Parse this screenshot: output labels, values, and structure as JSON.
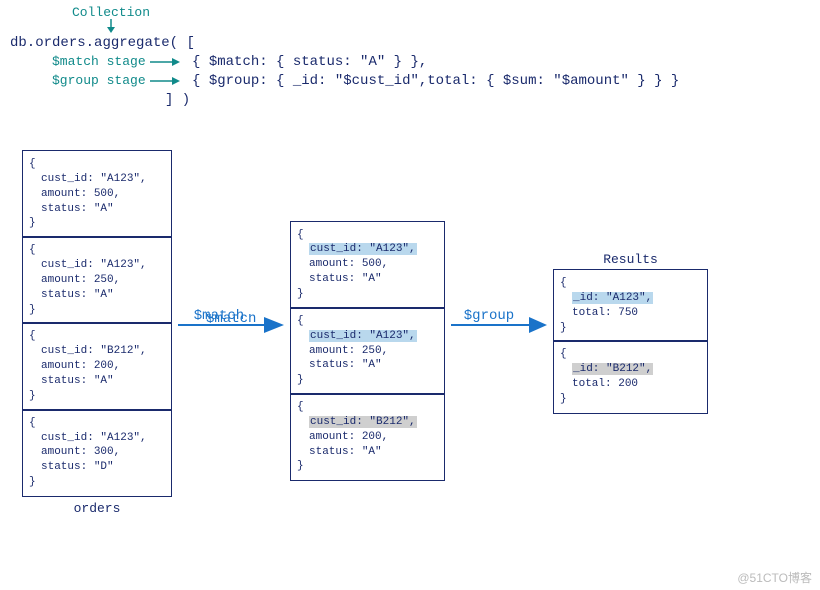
{
  "code": {
    "collection_label": "Collection",
    "line1_pre": "db.",
    "line1_coll": "orders",
    "line1_post": ".aggregate( [",
    "match_label": "$match stage",
    "match_line": "{ $match: { status: \"A\" } },",
    "group_label": "$group stage",
    "group_line": "{ $group: { _id: \"$cust_id\",total: { $sum: \"$amount\" } } }",
    "close_line": "] )"
  },
  "stages": {
    "match": "$match",
    "group": "$group"
  },
  "orders_title": "orders",
  "orders": [
    {
      "cust_id": "\"A123\"",
      "amount": "500",
      "status": "\"A\""
    },
    {
      "cust_id": "\"A123\"",
      "amount": "250",
      "status": "\"A\""
    },
    {
      "cust_id": "\"B212\"",
      "amount": "200",
      "status": "\"A\""
    },
    {
      "cust_id": "\"A123\"",
      "amount": "300",
      "status": "\"D\""
    }
  ],
  "matched": [
    {
      "cust_id": "\"A123\"",
      "amount": "500",
      "status": "\"A\"",
      "hl": "blue"
    },
    {
      "cust_id": "\"A123\"",
      "amount": "250",
      "status": "\"A\"",
      "hl": "blue"
    },
    {
      "cust_id": "\"B212\"",
      "amount": "200",
      "status": "\"A\"",
      "hl": "gray"
    }
  ],
  "results_title": "Results",
  "results": [
    {
      "_id": "\"A123\"",
      "total": "750",
      "hl": "blue"
    },
    {
      "_id": "\"B212\"",
      "total": "200",
      "hl": "gray"
    }
  ],
  "watermark": "@51CTO博客",
  "chart_data": {
    "type": "table",
    "description": "MongoDB aggregation pipeline diagram: db.orders.aggregate with $match then $group",
    "input_collection": "orders",
    "input_docs": [
      {
        "cust_id": "A123",
        "amount": 500,
        "status": "A"
      },
      {
        "cust_id": "A123",
        "amount": 250,
        "status": "A"
      },
      {
        "cust_id": "B212",
        "amount": 200,
        "status": "A"
      },
      {
        "cust_id": "A123",
        "amount": 300,
        "status": "D"
      }
    ],
    "pipeline": [
      {
        "$match": {
          "status": "A"
        }
      },
      {
        "$group": {
          "_id": "$cust_id",
          "total": {
            "$sum": "$amount"
          }
        }
      }
    ],
    "after_match": [
      {
        "cust_id": "A123",
        "amount": 500,
        "status": "A"
      },
      {
        "cust_id": "A123",
        "amount": 250,
        "status": "A"
      },
      {
        "cust_id": "B212",
        "amount": 200,
        "status": "A"
      }
    ],
    "results": [
      {
        "_id": "A123",
        "total": 750
      },
      {
        "_id": "B212",
        "total": 200
      }
    ]
  }
}
